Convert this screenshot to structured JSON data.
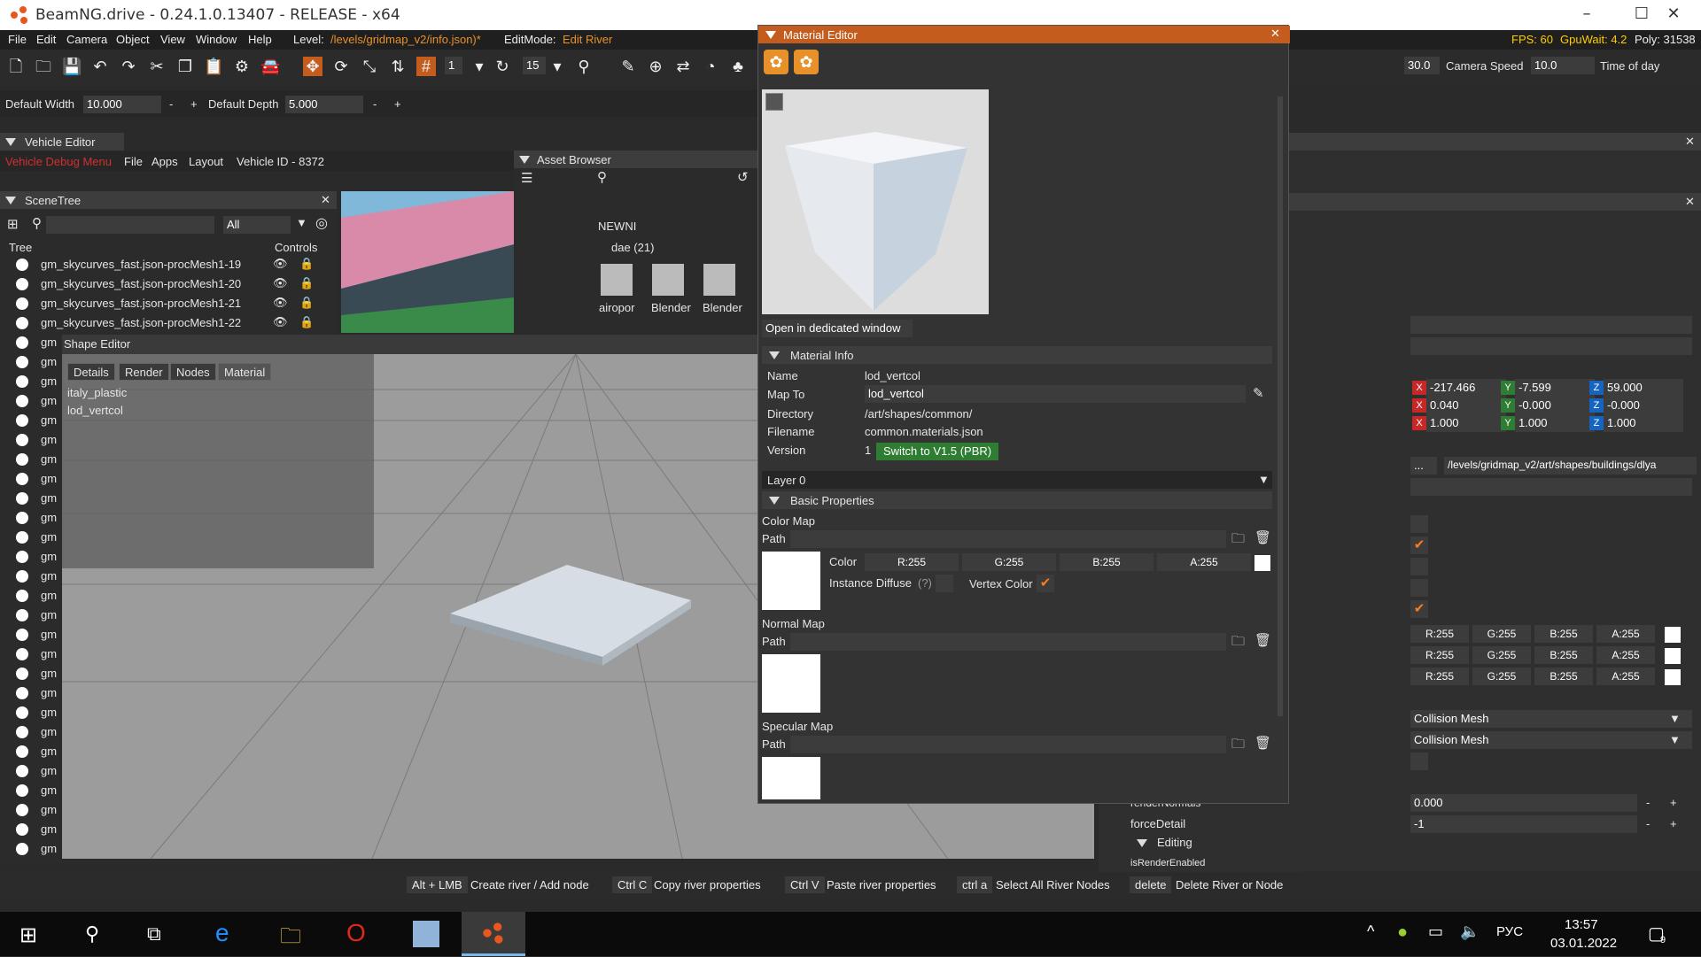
{
  "window": {
    "title": "BeamNG.drive - 0.24.1.0.13407 - RELEASE - x64",
    "minimize": "–",
    "maximize": "☐",
    "close": "✕"
  },
  "menu": {
    "items": [
      "File",
      "Edit",
      "Camera",
      "Object",
      "View",
      "Window",
      "Help"
    ],
    "level_label": "Level:",
    "level_value": "/levels/gridmap_v2/info.json)*",
    "editmode_label": "EditMode:",
    "editmode_value": "Edit River",
    "fps": "FPS: 60",
    "gpuwait": "GpuWait: 4.2",
    "poly": "Poly: 31538"
  },
  "toolbar": {
    "field_1": "1",
    "field_15": "15",
    "camera_speed_value": "30.0",
    "camera_speed_label": "Camera Speed",
    "time_value": "10.0",
    "time_label": "Time of day"
  },
  "river": {
    "width_label": "Default Width",
    "width_value": "10.000",
    "depth_label": "Default Depth",
    "depth_value": "5.000",
    "minus": "-",
    "plus": "+"
  },
  "vehicle_editor": {
    "title": "Vehicle Editor",
    "debug_menu": "Vehicle Debug Menu",
    "file": "File",
    "apps": "Apps",
    "layout": "Layout",
    "vehicle_id": "Vehicle ID - 8372"
  },
  "asset_browser": {
    "title": "Asset Browser",
    "newni": "NEWNI",
    "dae": "dae (21)",
    "items": [
      "airopor",
      "Blender",
      "Blender"
    ]
  },
  "scene_tree": {
    "title": "SceneTree",
    "filter": "All",
    "col_tree": "Tree",
    "col_controls": "Controls",
    "rows": [
      "gm_skycurves_fast.json-procMesh1-19",
      "gm_skycurves_fast.json-procMesh1-20",
      "gm_skycurves_fast.json-procMesh1-21",
      "gm_skycurves_fast.json-procMesh1-22"
    ],
    "short_row": "gm",
    "short_count": 27
  },
  "shape_editor": {
    "title": "Shape Editor",
    "tabs": [
      "Details",
      "Render",
      "Nodes",
      "Material"
    ],
    "materials": [
      "italy_plastic",
      "lod_vertcol"
    ]
  },
  "material_editor": {
    "title": "Material Editor",
    "open_dedicated": "Open in dedicated window",
    "material_info": "Material Info",
    "name_label": "Name",
    "name_value": "lod_vertcol",
    "mapto_label": "Map To",
    "mapto_value": "lod_vertcol",
    "directory_label": "Directory",
    "directory_value": "/art/shapes/common/",
    "filename_label": "Filename",
    "filename_value": "common.materials.json",
    "version_label": "Version",
    "version_value": "1",
    "switch_btn": "Switch to V1.5 (PBR)",
    "layer": "Layer 0",
    "basic_props": "Basic Properties",
    "color_map": "Color Map",
    "path": "Path",
    "color_label": "Color",
    "r": "R:255",
    "g": "G:255",
    "b": "B:255",
    "a": "A:255",
    "instance_diffuse": "Instance Diffuse",
    "help": "(?)",
    "vertex_color": "Vertex Color",
    "normal_map": "Normal Map",
    "specular_map": "Specular Map"
  },
  "inspector": {
    "pos": {
      "x": "-217.466",
      "y": "-7.599",
      "z": "59.000"
    },
    "rot": {
      "x": "0.040",
      "y": "-0.000",
      "z": "-0.000"
    },
    "scale": {
      "x": "1.000",
      "y": "1.000",
      "z": "1.000"
    },
    "ellipsis": "...",
    "shape_path": "/levels/gridmap_v2/art/shapes/buildings/dlya",
    "dots": "...",
    "colors": [
      {
        "r": "R:255",
        "g": "G:255",
        "b": "B:255",
        "a": "A:255"
      },
      {
        "r": "R:255",
        "g": "G:255",
        "b": "B:255",
        "a": "A:255"
      },
      {
        "r": "R:255",
        "g": "G:255",
        "b": "B:255",
        "a": "A:255"
      }
    ],
    "collision1": "Collision Mesh",
    "collision2": "Collision Mesh",
    "render_normals_label": "renderNormals",
    "render_normals_value": "0.000",
    "force_detail_label": "forceDetail",
    "force_detail_value": "-1",
    "editing": "Editing",
    "is_render_enabled": "isRenderEnabled"
  },
  "status": {
    "k1": "Alt + LMB",
    "d1": "Create river / Add node",
    "k2": "Ctrl C",
    "d2": "Copy river properties",
    "k3": "Ctrl V",
    "d3": "Paste river properties",
    "k4": "ctrl a",
    "d4": "Select All River Nodes",
    "k5": "delete",
    "d5": "Delete River or Node"
  },
  "taskbar": {
    "lang": "РУС",
    "time": "13:57",
    "date": "03.01.2022",
    "notif": "9"
  },
  "colors": {
    "accent": "#ff7a1a",
    "title_orange": "#c45c1e",
    "green_btn": "#2e7d32"
  }
}
